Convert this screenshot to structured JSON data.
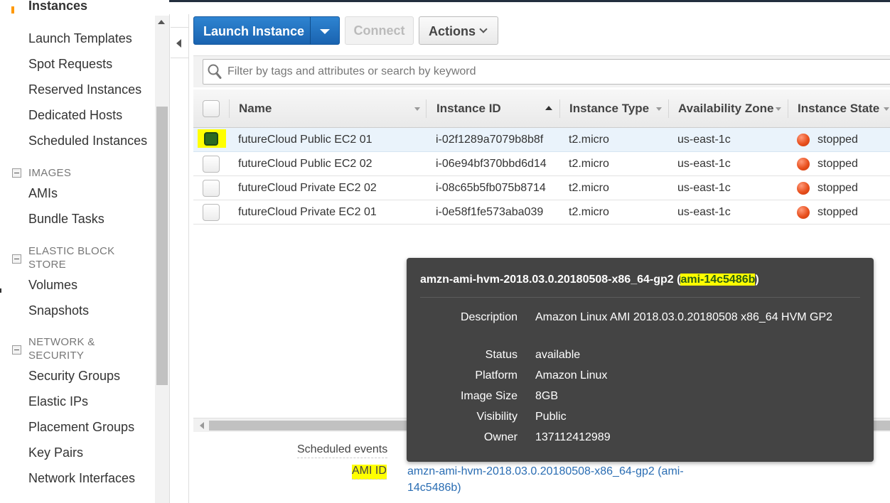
{
  "sidebar": {
    "partial_item": "Instances",
    "items_top": [
      "Launch Templates",
      "Spot Requests",
      "Reserved Instances",
      "Dedicated Hosts",
      "Scheduled Instances"
    ],
    "images_header": "IMAGES",
    "images_items": [
      "AMIs",
      "Bundle Tasks"
    ],
    "ebs_header": "ELASTIC BLOCK STORE",
    "ebs_items": [
      "Volumes",
      "Snapshots"
    ],
    "network_header": "NETWORK & SECURITY",
    "network_items": [
      "Security Groups",
      "Elastic IPs",
      "Placement Groups",
      "Key Pairs",
      "Network Interfaces"
    ]
  },
  "toolbar": {
    "launch_label": "Launch Instance",
    "connect_label": "Connect",
    "actions_label": "Actions"
  },
  "search": {
    "placeholder": "Filter by tags and attributes or search by keyword"
  },
  "table": {
    "columns": [
      "Name",
      "Instance ID",
      "Instance Type",
      "Availability Zone",
      "Instance State"
    ],
    "rows": [
      {
        "name": "futureCloud Public EC2 01",
        "id": "i-02f1289a7079b8b8f",
        "type": "t2.micro",
        "az": "us-east-1c",
        "state": "stopped",
        "selected": true
      },
      {
        "name": "futureCloud Public EC2 02",
        "id": "i-06e94bf370bbd6d14",
        "type": "t2.micro",
        "az": "us-east-1c",
        "state": "stopped",
        "selected": false
      },
      {
        "name": "futureCloud Private EC2 02",
        "id": "i-08c65b5fb075b8714",
        "type": "t2.micro",
        "az": "us-east-1c",
        "state": "stopped",
        "selected": false
      },
      {
        "name": "futureCloud Private EC2 01",
        "id": "i-0e58f1fe573aba039",
        "type": "t2.micro",
        "az": "us-east-1c",
        "state": "stopped",
        "selected": false
      }
    ]
  },
  "details": {
    "scheduled_events_label": "Scheduled events",
    "ami_id_label": "AMI ID",
    "ami_id_value": "amzn-ami-hvm-2018.03.0.20180508-x86_64-gp2 (ami-14c5486b)"
  },
  "tooltip": {
    "title_prefix": "amzn-ami-hvm-2018.03.0.20180508-x86_64-gp2 (",
    "title_ami": "ami-14c5486b",
    "title_suffix": ")",
    "fields": [
      {
        "key": "Description",
        "value": "Amazon Linux AMI 2018.03.0.20180508 x86_64 HVM GP2"
      },
      {
        "key": "Status",
        "value": "available"
      },
      {
        "key": "Platform",
        "value": "Amazon Linux"
      },
      {
        "key": "Image Size",
        "value": "8GB"
      },
      {
        "key": "Visibility",
        "value": "Public"
      },
      {
        "key": "Owner",
        "value": "137112412989"
      }
    ]
  },
  "colors": {
    "primary_button": "#1a63b0",
    "stopped_state": "#e8501e",
    "highlight": "#ffff00",
    "tooltip_bg": "#444444",
    "link": "#2a6db3"
  }
}
